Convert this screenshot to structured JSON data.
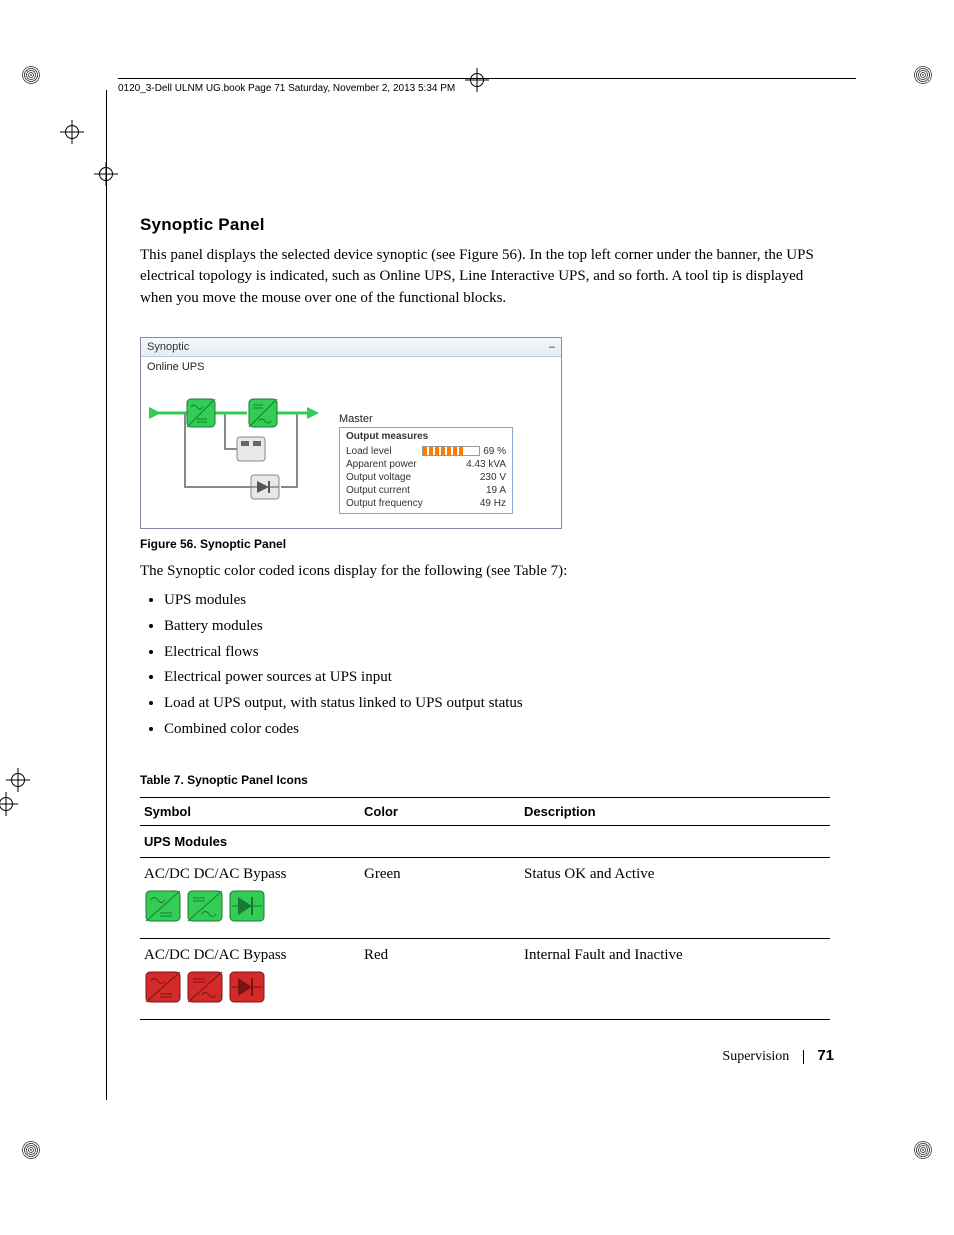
{
  "header": {
    "line": "0120_3-Dell ULNM UG.book  Page 71  Saturday, November 2, 2013  5:34 PM"
  },
  "section": {
    "title": "Synoptic Panel",
    "intro": "This panel displays the selected device synoptic (see Figure 56). In the top left corner under the banner, the UPS electrical topology is indicated, such as Online UPS, Line Interactive UPS, and so forth. A tool tip is displayed when you move the mouse over one of the functional blocks."
  },
  "panel": {
    "title": "Synoptic",
    "collapse_glyph": "–",
    "topology": "Online UPS",
    "master_label": "Master",
    "tooltip": {
      "title": "Output measures",
      "rows": [
        {
          "label": "Load level",
          "value": "69 %",
          "bar": true
        },
        {
          "label": "Apparent power",
          "value": "4.43 kVA"
        },
        {
          "label": "Output voltage",
          "value": "230 V"
        },
        {
          "label": "Output current",
          "value": "19 A"
        },
        {
          "label": "Output frequency",
          "value": "49 Hz"
        }
      ]
    }
  },
  "figure_caption": "Figure 56.  Synoptic Panel",
  "after_figure": "The Synoptic color coded icons display for the following (see Table 7):",
  "bullets": [
    "UPS modules",
    "Battery modules",
    "Electrical flows",
    "Electrical power sources at UPS input",
    "Load at UPS output, with status linked to UPS output status",
    "Combined color codes"
  ],
  "table_title": "Table 7.   Synoptic Panel Icons",
  "table": {
    "headers": [
      "Symbol",
      "Color",
      "Description"
    ],
    "sub_header": "UPS Modules",
    "rows": [
      {
        "symbol": "AC/DC DC/AC Bypass",
        "color": "Green",
        "desc": "Status OK and Active",
        "hex": "#33cc55"
      },
      {
        "symbol": "AC/DC DC/AC Bypass",
        "color": "Red",
        "desc": "Internal Fault and Inactive",
        "hex": "#d42a2a"
      }
    ]
  },
  "footer": {
    "chapter": "Supervision",
    "page": "71"
  }
}
